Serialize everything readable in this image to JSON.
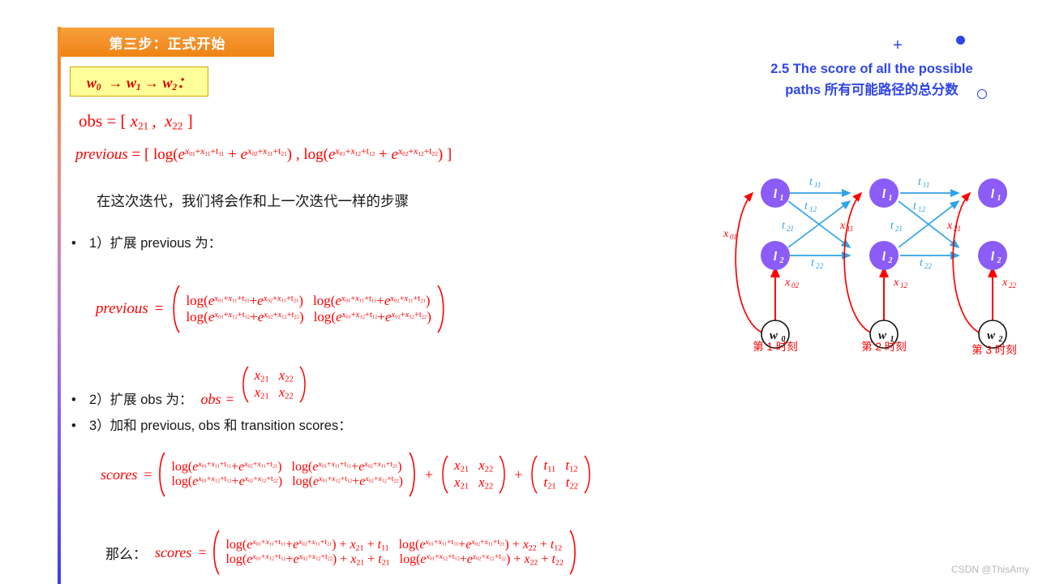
{
  "banner": {
    "title": "第三步：正式开始"
  },
  "yellow_box": {
    "text": "w₀ → w₁ → w₂："
  },
  "right_heading": {
    "line1": "2.5 The score of all the possible",
    "line2": "paths 所有可能路径的总分数"
  },
  "equations": {
    "obs_label": "obs",
    "obs_value": "[ x₂₁ ,  x₂₂ ]",
    "previous_label": "previous",
    "previous_value": "[ log(e^{x01+x11+t11} + e^{x02+x11+t21}) , log(e^{x01+x12+t12} + e^{x02+x12+t22}) ]",
    "scores_label": "scores",
    "then_label": "那么："
  },
  "body_text": {
    "intro": "在这次迭代，我们将会作和上一次迭代一样的步骤",
    "bullet1": "1）扩展 previous 为：",
    "bullet2": "2）扩展 obs 为：",
    "bullet3": "3）加和 previous, obs 和 transition scores："
  },
  "matrices": {
    "previous": {
      "rows": [
        [
          "log(e^{x01+x11+t11}+e^{x02+x11+t21})",
          "log(e^{x01+x11+t11}+e^{x02+x11+t21})"
        ],
        [
          "log(e^{x01+x12+t12}+e^{x02+x12+t22})",
          "log(e^{x01+x12+t12}+e^{x02+x12+t22})"
        ]
      ]
    },
    "obs": {
      "rows": [
        [
          "x₂₁",
          "x₂₂"
        ],
        [
          "x₂₁",
          "x₂₂"
        ]
      ]
    },
    "transition": {
      "rows": [
        [
          "t₁₁",
          "t₁₂"
        ],
        [
          "t₂₁",
          "t₂₂"
        ]
      ]
    },
    "final": {
      "rows": [
        [
          "log(e^{x01+x11+t11}+e^{x02+x11+t21}) + x₂₁ + t₁₁",
          "log(e^{x01+x11+t11}+e^{x02+x11+t21}) + x₂₂ + t₁₂"
        ],
        [
          "log(e^{x01+x12+t12}+e^{x02+x12+t22}) + x₂₁ + t₂₁",
          "log(e^{x01+x12+t12}+e^{x02+x12+t22}) + x₂₂ + t₂₂"
        ]
      ]
    },
    "plus": "+",
    "equals": "="
  },
  "diagram": {
    "states": [
      "l₁",
      "l₂"
    ],
    "word_nodes": [
      "w₀",
      "w₁",
      "w₂"
    ],
    "time_labels": [
      "第 1 时刻",
      "第 2 时刻",
      "第 3 时刻"
    ],
    "transition_labels": [
      "t₁₁",
      "t₁₂",
      "t₂₁",
      "t₂₂"
    ],
    "emission_labels": [
      "x₀₁",
      "x₀₂",
      "x₁₁",
      "x₁₂",
      "x₂₁",
      "x₂₂"
    ],
    "colors": {
      "state_node": "#8B5CF6",
      "transition_arrow": "#2FA3E8",
      "emission_arrow": "#FF0000",
      "word_node_border": "#111111"
    }
  },
  "watermark": {
    "text": "CSDN @ThisAmy"
  },
  "theme": {
    "banner_orange": "#EE8413",
    "heading_blue": "#2F46E8",
    "math_red": "#FF0000",
    "yellow_box": "#FFFF99"
  }
}
